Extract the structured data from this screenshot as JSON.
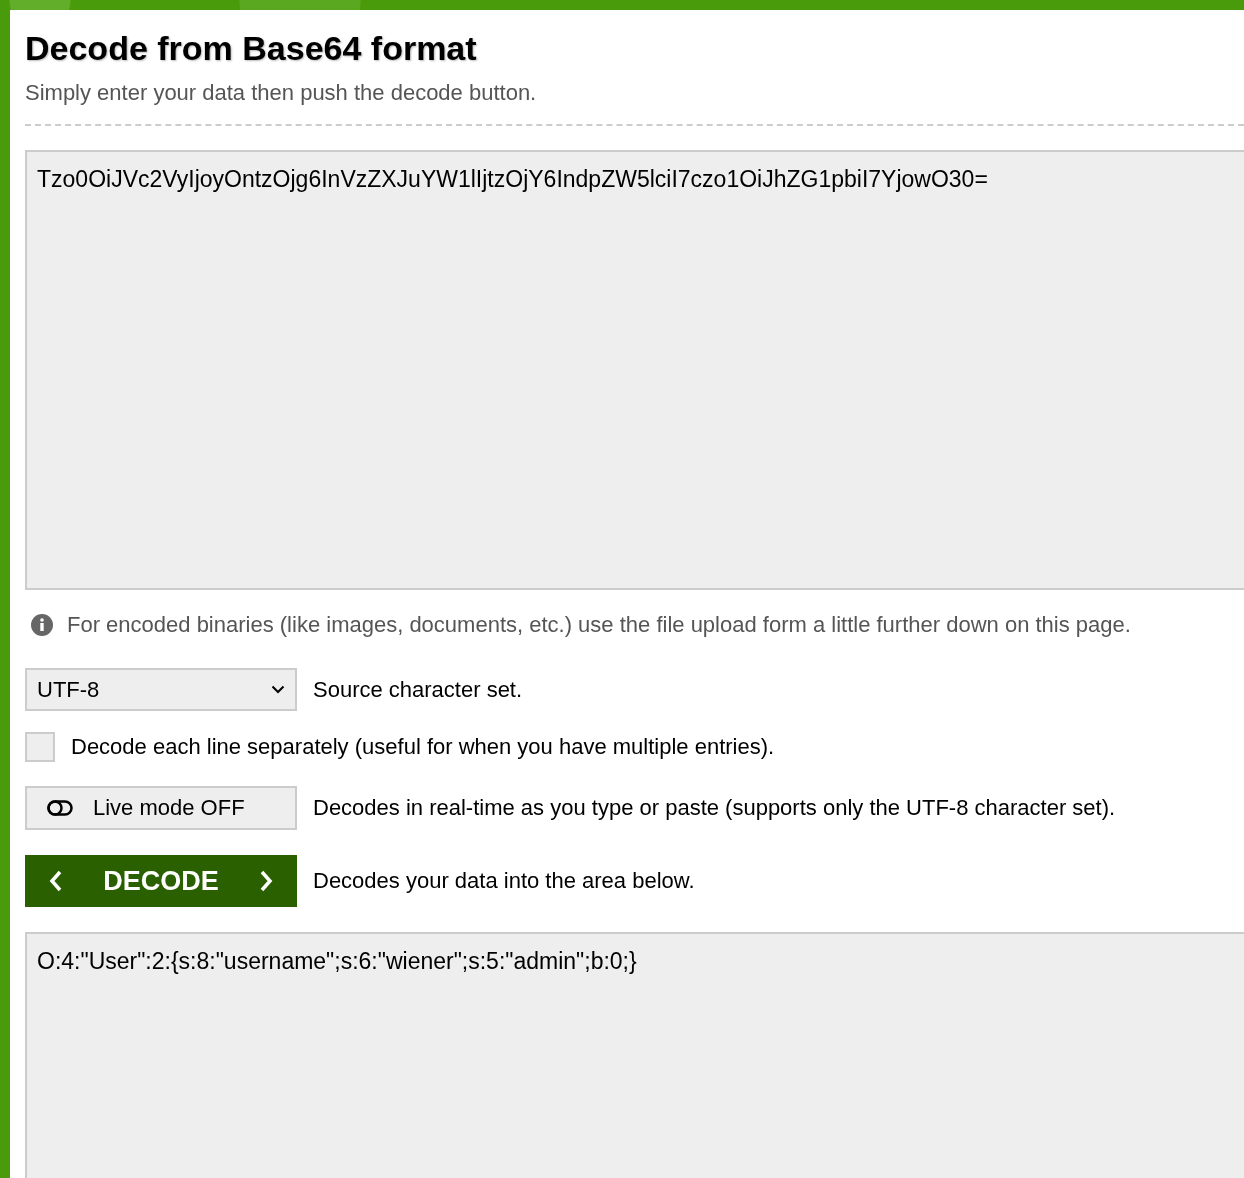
{
  "header": {
    "title": "Decode from Base64 format",
    "subtitle": "Simply enter your data then push the decode button."
  },
  "input": {
    "value": "Tzo0OiJVc2VyIjoyOntzOjg6InVzZXJuYW1lIjtzOjY6IndpZW5lciI7czo1OiJhZG1pbiI7YjowO30="
  },
  "info": {
    "text": "For encoded binaries (like images, documents, etc.) use the file upload form a little further down on this page."
  },
  "charset": {
    "value": "UTF-8",
    "description": "Source character set."
  },
  "options": [
    {
      "kind": "checkbox",
      "label": "Decode each line separately (useful for when you have multiple entries).",
      "checked": false
    },
    {
      "kind": "toggle",
      "label": "Live mode OFF",
      "on": false,
      "description": "Decodes in real-time as you type or paste (supports only the UTF-8 character set)."
    }
  ],
  "decode": {
    "label": "DECODE",
    "description": "Decodes your data into the area below."
  },
  "output": {
    "value": "O:4:\"User\":2:{s:8:\"username\";s:6:\"wiener\";s:5:\"admin\";b:0;}"
  }
}
